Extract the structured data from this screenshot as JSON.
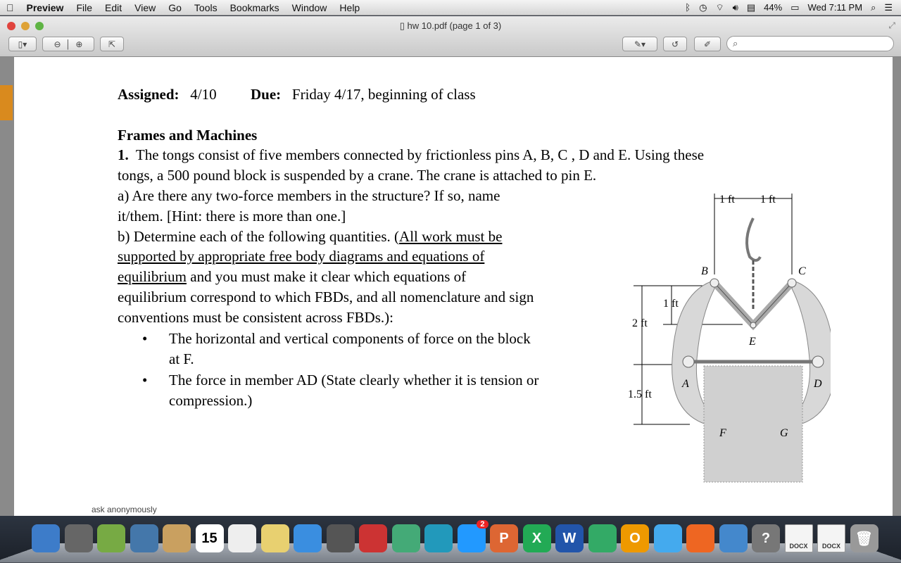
{
  "menubar": {
    "app": "Preview",
    "items": [
      "File",
      "Edit",
      "View",
      "Go",
      "Tools",
      "Bookmarks",
      "Window",
      "Help"
    ],
    "battery": "44%",
    "clock": "Wed 7:11 PM"
  },
  "window": {
    "title": "hw 10.pdf (page 1 of 3)",
    "search_placeholder": ""
  },
  "doc": {
    "assigned_label": "Assigned:",
    "assigned_value": "4/10",
    "due_label": "Due:",
    "due_value": "Friday 4/17, beginning of class",
    "section": "Frames and Machines",
    "p1_num": "1.",
    "p1_a": "The tongs consist of five members connected by frictionless pins A, B, C , D and E.  Using these",
    "p1_b": "tongs, a 500 pound block is suspended by a crane.  The crane is attached to pin E.",
    "qa1": "a)  Are there any two-force members in the structure?  If so, name",
    "qa2": "it/them.  [Hint: there is more than one.]",
    "qb1a": "b) Determine each of the following quantities.  (",
    "qb1b": "All work must be ",
    "qb2": "supported by appropriate free body diagrams and equations of ",
    "qb3a": "equilibrium",
    "qb3b": " and you must make it clear which equations of",
    "qb4": "equilibrium correspond to which FBDs, and all nomenclature and sign",
    "qb5": "conventions must be consistent across FBDs.):",
    "bullets": [
      [
        "The horizontal and vertical components of force on the block",
        "at F."
      ],
      [
        "The force in member AD (State clearly whether it is tension or",
        "compression.)"
      ]
    ]
  },
  "figure": {
    "dims": [
      "1 ft",
      "1 ft",
      "1 ft",
      "2 ft",
      "1.5 ft"
    ],
    "labels": [
      "A",
      "B",
      "C",
      "D",
      "E",
      "F",
      "G"
    ]
  },
  "behind_text": "ask anonymously",
  "dock": {
    "items": [
      "Finder",
      "Launchpad",
      "Photo Booth",
      "Mail",
      "Contacts",
      "Calendar",
      "Reminders",
      "Notes",
      "Messages",
      "FaceTime",
      "Photo",
      "iPhoto",
      "iTunes",
      "App Store",
      "PowerPoint",
      "Excel",
      "Word",
      "Network",
      "Outlook",
      "Safari",
      "Firefox",
      "Preview",
      "Help",
      "DOCX",
      "DOCX",
      "Trash"
    ],
    "calendar_day": "15",
    "appstore_badge": "2"
  }
}
